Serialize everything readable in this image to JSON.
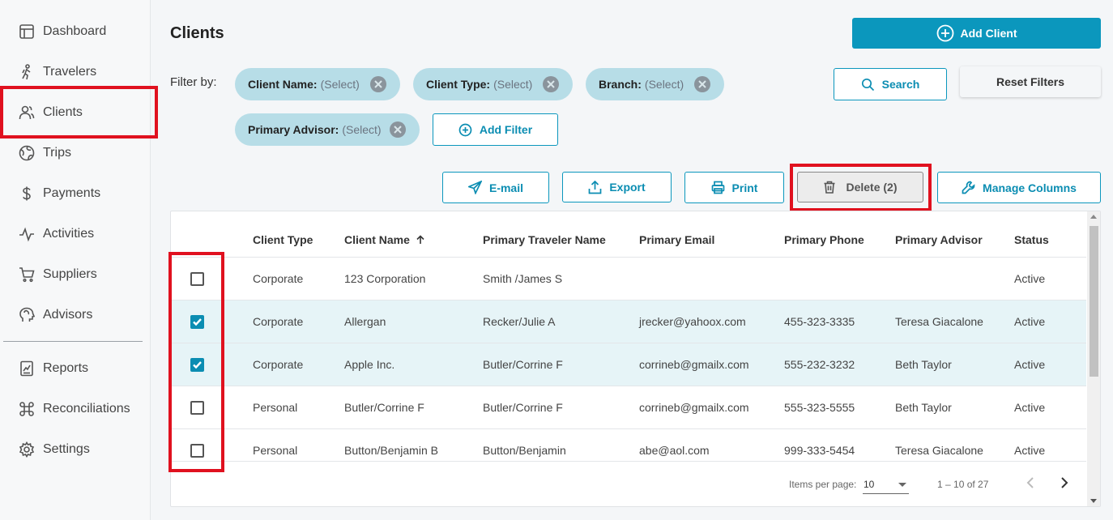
{
  "sidebar": {
    "items": [
      {
        "label": "Dashboard",
        "icon": "dashboard-icon"
      },
      {
        "label": "Travelers",
        "icon": "traveler-icon"
      },
      {
        "label": "Clients",
        "icon": "users-icon"
      },
      {
        "label": "Trips",
        "icon": "globe-icon"
      },
      {
        "label": "Payments",
        "icon": "dollar-icon"
      },
      {
        "label": "Activities",
        "icon": "activity-icon"
      },
      {
        "label": "Suppliers",
        "icon": "cart-icon"
      },
      {
        "label": "Advisors",
        "icon": "advisor-head-icon"
      },
      {
        "label": "Reports",
        "icon": "report-icon"
      },
      {
        "label": "Reconciliations",
        "icon": "command-icon"
      },
      {
        "label": "Settings",
        "icon": "gear-icon"
      }
    ]
  },
  "header": {
    "title": "Clients",
    "add_client_label": "Add Client"
  },
  "filters": {
    "label": "Filter by:",
    "chips": [
      {
        "key": "Client Name:",
        "value": "(Select)"
      },
      {
        "key": "Client Type:",
        "value": "(Select)"
      },
      {
        "key": "Branch:",
        "value": "(Select)"
      },
      {
        "key": "Primary Advisor:",
        "value": "(Select)"
      }
    ],
    "add_filter_label": "Add Filter",
    "search_label": "Search",
    "reset_label": "Reset Filters"
  },
  "toolbar": {
    "email_label": "E-mail",
    "export_label": "Export",
    "print_label": "Print",
    "delete_label": "Delete (2)",
    "manage_columns_label": "Manage Columns"
  },
  "table": {
    "columns": [
      "Client Type",
      "Client Name",
      "Primary Traveler Name",
      "Primary Email",
      "Primary Phone",
      "Primary Advisor",
      "Status"
    ],
    "sort_indicator": "ascending",
    "rows": [
      {
        "checked": false,
        "type": "Corporate",
        "name": "123 Corporation",
        "traveler": "Smith /James S",
        "email": "",
        "phone": "",
        "advisor": "",
        "status": "Active"
      },
      {
        "checked": true,
        "type": "Corporate",
        "name": "Allergan",
        "traveler": "Recker/Julie A",
        "email": "jrecker@yahoox.com",
        "phone": "455-323-3335",
        "advisor": "Teresa Giacalone",
        "status": "Active"
      },
      {
        "checked": true,
        "type": "Corporate",
        "name": "Apple Inc.",
        "traveler": "Butler/Corrine F",
        "email": "corrineb@gmailx.com",
        "phone": "555-232-3232",
        "advisor": "Beth Taylor",
        "status": "Active"
      },
      {
        "checked": false,
        "type": "Personal",
        "name": "Butler/Corrine F",
        "traveler": "Butler/Corrine F",
        "email": "corrineb@gmailx.com",
        "phone": "555-323-5555",
        "advisor": "Beth Taylor",
        "status": "Active"
      },
      {
        "checked": false,
        "type": "Personal",
        "name": "Button/Benjamin B",
        "traveler": "Button/Benjamin",
        "email": "abe@aol.com",
        "phone": "999-333-5454",
        "advisor": "Teresa Giacalone",
        "status": "Active"
      }
    ]
  },
  "pagination": {
    "items_per_page_label": "Items per page:",
    "items_per_page_value": "10",
    "range_label": "1 – 10 of 27"
  },
  "colors": {
    "accent": "#0b97bd",
    "chip_bg": "#b7dde7",
    "highlight": "#e0111f",
    "selected_row": "#e6f4f7"
  }
}
